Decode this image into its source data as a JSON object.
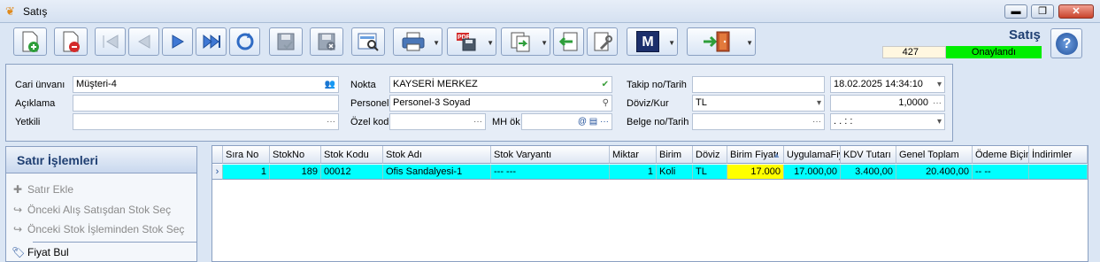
{
  "window": {
    "title": "Satış",
    "min": "▬",
    "max": "❐",
    "close": "✕"
  },
  "header": {
    "title": "Satış",
    "doc_number": "427",
    "status": "Onaylandı",
    "help": "?"
  },
  "form": {
    "cari_unvani_label": "Cari ünvanı",
    "cari_unvani": "Müşteri-4",
    "aciklama_label": "Açıklama",
    "aciklama": "",
    "yetkili_label": "Yetkili",
    "yetkili": "",
    "nokta_label": "Nokta",
    "nokta": "KAYSERİ MERKEZ",
    "personel_label": "Personel",
    "personel": "Personel-3 Soyad",
    "ozel_kod_label": "Özel kod",
    "ozel_kod": "",
    "mh_ok_label": "MH ök",
    "mh_ok": "",
    "takip_label": "Takip no/Tarih",
    "takip_no": "",
    "takip_tarih": "18.02.2025 14:34:10",
    "doviz_label": "Döviz/Kur",
    "doviz": "TL",
    "kur": "1,0000",
    "belge_label": "Belge no/Tarih",
    "belge_no": "",
    "belge_tarih": ".  .     :  :"
  },
  "panel": {
    "title": "Satır İşlemleri",
    "items": [
      "Satır Ekle",
      "Önceki Alış Satışdan Stok Seç",
      "Önceki Stok İşleminden Stok Seç",
      "Fiyat Bul"
    ]
  },
  "grid": {
    "columns": [
      "Sıra No",
      "StokNo",
      "Stok Kodu",
      "Stok Adı",
      "Stok Varyantı",
      "Miktar",
      "Birim",
      "Döviz",
      "Birim Fiyatı",
      "UygulamaFiyatı",
      "KDV Tutarı",
      "Genel Toplam",
      "Ödeme Biçimi",
      "İndirimler"
    ],
    "rows": [
      [
        "1",
        "189",
        "00012",
        "Ofis Sandalyesi-1",
        "--- ---",
        "1",
        "Koli",
        "TL",
        "17.000",
        "17.000,00",
        "3.400,00",
        "20.400,00",
        "-- --",
        ""
      ]
    ]
  },
  "colors": {
    "status_ok": "#00ee00",
    "selected_row": "#00ffff",
    "edit_cell": "#ffff00"
  }
}
